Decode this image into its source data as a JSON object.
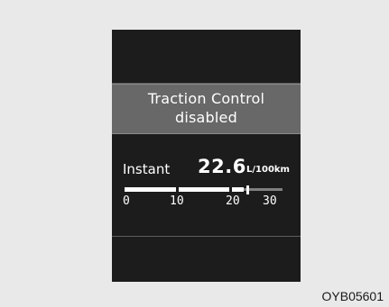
{
  "display": {
    "message": {
      "line1": "Traction Control",
      "line2": "disabled"
    },
    "fuel_economy": {
      "label": "Instant",
      "value": "22.6",
      "unit": "L/100km",
      "gauge": {
        "min": 0,
        "max": 30,
        "current": 22.6,
        "ticks": [
          "0",
          "10",
          "20",
          "30"
        ]
      }
    }
  },
  "figure_code": "OYB05601",
  "colors": {
    "page_background": "#e9e9e9",
    "display_background": "#1c1c1c",
    "banner_background": "#686868",
    "text": "#ffffff",
    "gauge_fill": "#ffffff",
    "gauge_track": "#808080"
  }
}
